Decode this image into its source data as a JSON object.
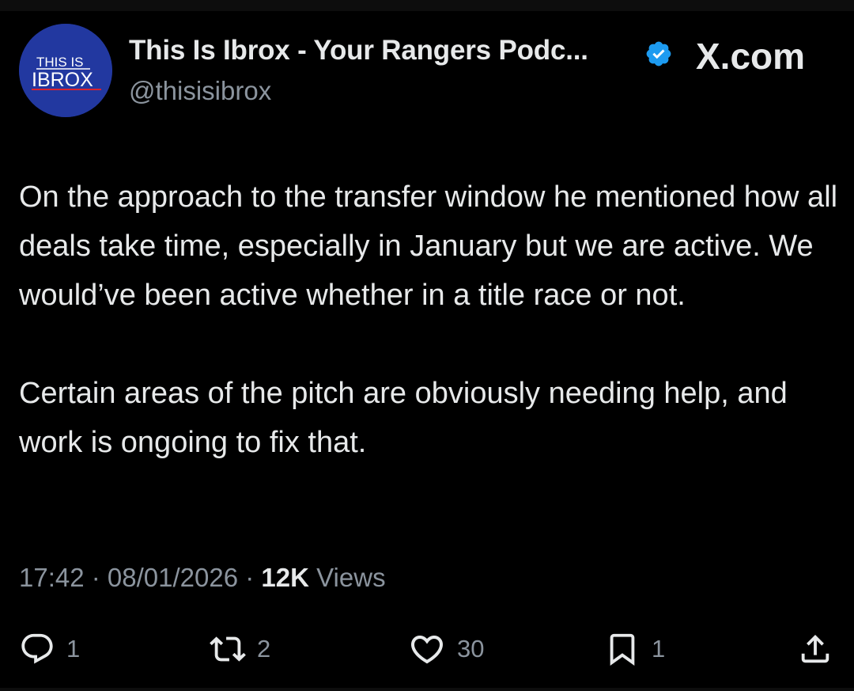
{
  "avatar": {
    "logo_line1": "THIS IS",
    "logo_line2": "IBROX"
  },
  "header": {
    "display_name": "This Is Ibrox - Your Rangers Podc...",
    "handle": "@thisisibrox",
    "site_label": "X.com"
  },
  "post": {
    "paragraphs": [
      "On the approach to the transfer window he mentioned how all deals take time, especially in January but we are active. We would’ve been active whether in a title race or not.",
      "Certain areas of the pitch are obviously needing help, and work is ongoing to fix that."
    ],
    "time": "17:42",
    "date": "08/01/2026",
    "views_count": "12K",
    "views_label": "Views",
    "separator": " · "
  },
  "actions": {
    "replies": "1",
    "reposts": "2",
    "likes": "30",
    "bookmarks": "1"
  },
  "colors": {
    "background": "#000000",
    "text_primary": "#e7e9ea",
    "text_secondary": "#8b949e",
    "verified_badge": "#1d9bf0",
    "avatar_blue": "#2238a0"
  },
  "icons": [
    "verified-badge-icon",
    "reply-icon",
    "repost-icon",
    "like-icon",
    "bookmark-icon",
    "share-icon"
  ]
}
